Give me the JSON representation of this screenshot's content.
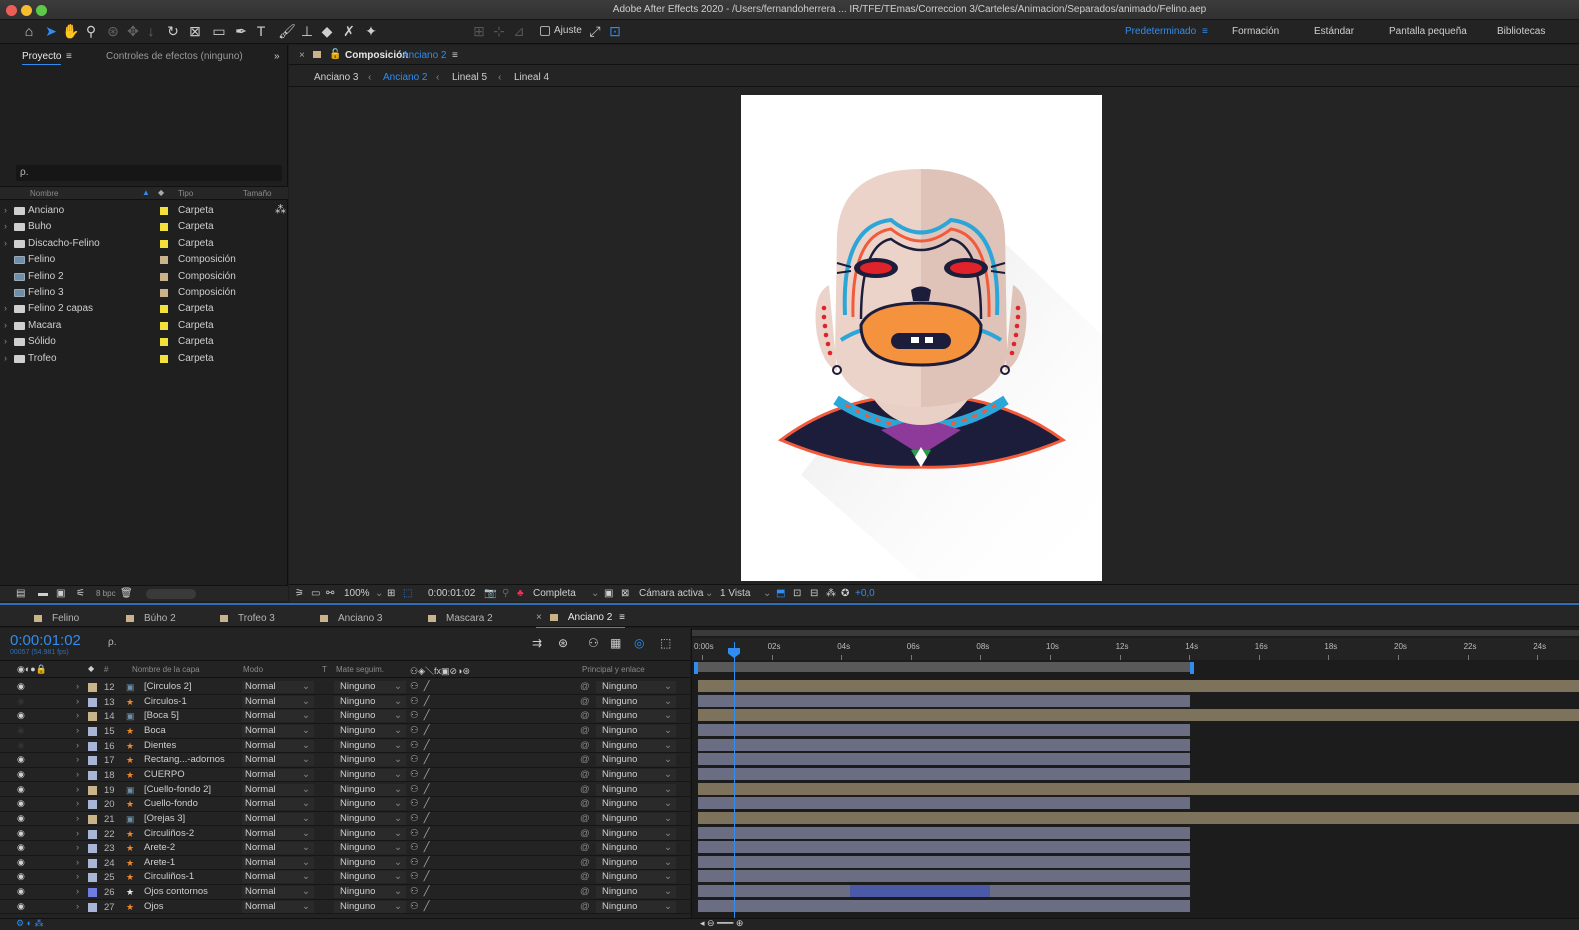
{
  "window": {
    "title": "Adobe After Effects 2020 - /Users/fernandoherrera ... IR/TFE/TEmas/Correccion 3/Carteles/Animacion/Separados/animado/Felino.aep"
  },
  "toolbar": {
    "snap_label": "Ajuste",
    "workspaces": [
      {
        "label": "Predeterminado",
        "active": true
      },
      {
        "label": "Formación",
        "active": false
      },
      {
        "label": "Estándar",
        "active": false
      },
      {
        "label": "Pantalla pequeña",
        "active": false
      },
      {
        "label": "Bibliotecas",
        "active": false
      }
    ]
  },
  "project_panel": {
    "tab_project": "Proyecto",
    "tab_effects": "Controles de efectos (ninguno)",
    "search_placeholder": "ρ.",
    "col_name": "Nombre",
    "col_type": "Tipo",
    "col_size": "Tamaño",
    "items": [
      {
        "name": "Anciano",
        "type": "Carpeta",
        "kind": "folder",
        "swatch": "#f2e13a"
      },
      {
        "name": "Buho",
        "type": "Carpeta",
        "kind": "folder",
        "swatch": "#f2e13a"
      },
      {
        "name": "Discacho-Felino",
        "type": "Carpeta",
        "kind": "folder",
        "swatch": "#f2e13a"
      },
      {
        "name": "Felino",
        "type": "Composición",
        "kind": "comp",
        "swatch": "#c9b48a"
      },
      {
        "name": "Felino 2",
        "type": "Composición",
        "kind": "comp",
        "swatch": "#c9b48a"
      },
      {
        "name": "Felino 3",
        "type": "Composición",
        "kind": "comp",
        "swatch": "#c9b48a"
      },
      {
        "name": "Felino 2 capas",
        "type": "Carpeta",
        "kind": "folder",
        "swatch": "#f2e13a"
      },
      {
        "name": "Macara",
        "type": "Carpeta",
        "kind": "folder",
        "swatch": "#f2e13a"
      },
      {
        "name": "Sólido",
        "type": "Carpeta",
        "kind": "folder",
        "swatch": "#f2e13a"
      },
      {
        "name": "Trofeo",
        "type": "Carpeta",
        "kind": "folder",
        "swatch": "#f2e13a"
      }
    ],
    "bpc": "8 bpc"
  },
  "composition_panel": {
    "prefix": "Composición",
    "name": "Anciano 2",
    "breadcrumbs": [
      {
        "label": "Anciano 3",
        "active": false
      },
      {
        "label": "Anciano 2",
        "active": true
      },
      {
        "label": "Lineal 5",
        "active": false
      },
      {
        "label": "Lineal 4",
        "active": false
      }
    ],
    "zoom": "100%",
    "timecode": "0:00:01:02",
    "resolution": "Completa",
    "camera": "Cámara activa",
    "views": "1 Vista",
    "exposure": "+0,0"
  },
  "timeline_tabs": [
    {
      "label": "Felino",
      "color": "#c9b48a",
      "active": false
    },
    {
      "label": "Búho 2",
      "color": "#c9b48a",
      "active": false
    },
    {
      "label": "Trofeo 3",
      "color": "#c9b48a",
      "active": false
    },
    {
      "label": "Anciano 3",
      "color": "#c9b48a",
      "active": false
    },
    {
      "label": "Mascara 2",
      "color": "#c9b48a",
      "active": false
    },
    {
      "label": "Anciano 2",
      "color": "#c9b48a",
      "active": true
    }
  ],
  "timeline": {
    "timecode": "0:00:01:02",
    "frame_info": "00057 (54.981 fps)",
    "search_placeholder": "ρ.",
    "col_layer_name": "Nombre de la capa",
    "col_mode": "Modo",
    "col_t": "T",
    "col_mate": "Mate seguim.",
    "col_parent": "Principal y enlace",
    "ruler": [
      "0:00s",
      "02s",
      "04s",
      "06s",
      "08s",
      "10s",
      "12s",
      "14s",
      "16s",
      "18s",
      "20s",
      "22s",
      "24s"
    ],
    "layers": [
      {
        "num": "12",
        "name": "[Circulos 2]",
        "kind": "precomp",
        "label_color": "#c9b48a",
        "visible": true,
        "mode": "Normal",
        "mate": "Ninguno",
        "parent": "Ninguno"
      },
      {
        "num": "13",
        "name": "Circulos-1",
        "kind": "shape",
        "label_color": "#a9b5d6",
        "visible": false,
        "mode": "Normal",
        "mate": "Ninguno",
        "parent": "Ninguno"
      },
      {
        "num": "14",
        "name": "[Boca 5]",
        "kind": "precomp",
        "label_color": "#c9b48a",
        "visible": true,
        "mode": "Normal",
        "mate": "Ninguno",
        "parent": "Ninguno"
      },
      {
        "num": "15",
        "name": "Boca",
        "kind": "shape",
        "label_color": "#a9b5d6",
        "visible": false,
        "mode": "Normal",
        "mate": "Ninguno",
        "parent": "Ninguno"
      },
      {
        "num": "16",
        "name": "Dientes",
        "kind": "shape",
        "label_color": "#a9b5d6",
        "visible": false,
        "mode": "Normal",
        "mate": "Ninguno",
        "parent": "Ninguno"
      },
      {
        "num": "17",
        "name": "Rectang...-adornos",
        "kind": "shape",
        "label_color": "#a9b5d6",
        "visible": true,
        "mode": "Normal",
        "mate": "Ninguno",
        "parent": "Ninguno"
      },
      {
        "num": "18",
        "name": "CUERPO",
        "kind": "shape",
        "label_color": "#a9b5d6",
        "visible": true,
        "mode": "Normal",
        "mate": "Ninguno",
        "parent": "Ninguno"
      },
      {
        "num": "19",
        "name": "[Cuello-fondo 2]",
        "kind": "precomp",
        "label_color": "#c9b48a",
        "visible": true,
        "mode": "Normal",
        "mate": "Ninguno",
        "parent": "Ninguno"
      },
      {
        "num": "20",
        "name": "Cuello-fondo",
        "kind": "shape",
        "label_color": "#a9b5d6",
        "visible": true,
        "mode": "Normal",
        "mate": "Ninguno",
        "parent": "Ninguno"
      },
      {
        "num": "21",
        "name": "[Orejas 3]",
        "kind": "precomp",
        "label_color": "#c9b48a",
        "visible": true,
        "mode": "Normal",
        "mate": "Ninguno",
        "parent": "Ninguno"
      },
      {
        "num": "22",
        "name": "Circuliños-2",
        "kind": "shape",
        "label_color": "#a9b5d6",
        "visible": true,
        "mode": "Normal",
        "mate": "Ninguno",
        "parent": "Ninguno"
      },
      {
        "num": "23",
        "name": "Arete-2",
        "kind": "shape",
        "label_color": "#a9b5d6",
        "visible": true,
        "mode": "Normal",
        "mate": "Ninguno",
        "parent": "Ninguno"
      },
      {
        "num": "24",
        "name": "Arete-1",
        "kind": "shape",
        "label_color": "#a9b5d6",
        "visible": true,
        "mode": "Normal",
        "mate": "Ninguno",
        "parent": "Ninguno"
      },
      {
        "num": "25",
        "name": "Circuliños-1",
        "kind": "shape",
        "label_color": "#a9b5d6",
        "visible": true,
        "mode": "Normal",
        "mate": "Ninguno",
        "parent": "Ninguno"
      },
      {
        "num": "26",
        "name": "Ojos contornos",
        "kind": "star",
        "label_color": "#6f7de0",
        "visible": true,
        "mode": "Normal",
        "mate": "Ninguno",
        "parent": "Ninguno"
      },
      {
        "num": "27",
        "name": "Ojos",
        "kind": "shape",
        "label_color": "#a9b5d6",
        "visible": true,
        "mode": "Normal",
        "mate": "Ninguno",
        "parent": "Ninguno"
      }
    ]
  },
  "colors": {
    "accent": "#2f8cf0",
    "precomp_bar": "#7d735c",
    "shape_bar": "#6b6d82",
    "selected_bar": "#4a5aa6"
  }
}
